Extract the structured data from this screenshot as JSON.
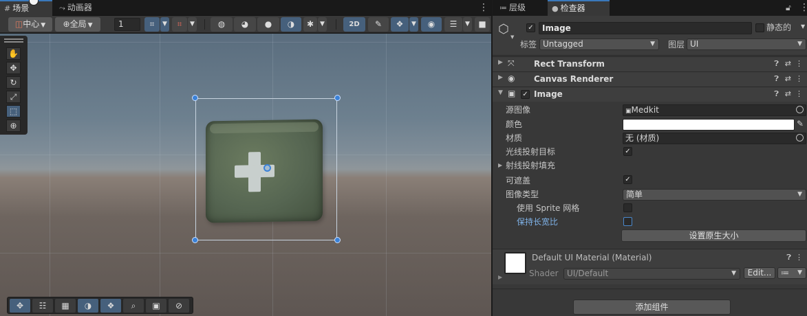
{
  "scene": {
    "tabs": [
      {
        "icon": "#",
        "label": "场景"
      },
      {
        "icon": "⤳",
        "label": "动画器"
      }
    ],
    "toolbar": {
      "pivot_label": "中心",
      "space_label": "全局",
      "grid_value": "1",
      "mode_2d": "2D"
    },
    "tools": [
      "hand-tool",
      "move-tool",
      "rotate-tool",
      "scale-tool",
      "rect-tool",
      "transform-tool"
    ]
  },
  "inspector": {
    "tabs": [
      {
        "icon": "≔",
        "label": "层级"
      },
      {
        "icon": "●",
        "label": "检查器"
      }
    ],
    "gameobject": {
      "name": "Image",
      "active": true,
      "static_label": "静态的",
      "tag_label": "标签",
      "tag_value": "Untagged",
      "layer_label": "图层",
      "layer_value": "UI"
    },
    "components": [
      {
        "title": "Rect Transform",
        "expanded": false
      },
      {
        "title": "Canvas Renderer",
        "expanded": false
      },
      {
        "title": "Image",
        "expanded": true
      }
    ],
    "image": {
      "source_label": "源图像",
      "source_value": "Medkit",
      "color_label": "颜色",
      "color_value": "#ffffff",
      "material_label": "材质",
      "material_value": "无 (材质)",
      "raycast_target_label": "光线投射目标",
      "raycast_target": true,
      "raycast_padding_label": "射线投射填充",
      "maskable_label": "可遮盖",
      "maskable": true,
      "image_type_label": "图像类型",
      "image_type_value": "简单",
      "use_sprite_mesh_label": "使用 Sprite 网格",
      "use_sprite_mesh": false,
      "preserve_aspect_label": "保持长宽比",
      "preserve_aspect": false,
      "set_native_size_label": "设置原生大小"
    },
    "material": {
      "title": "Default UI Material (Material)",
      "shader_label": "Shader",
      "shader_value": "UI/Default",
      "edit_label": "Edit..."
    },
    "add_component_label": "添加组件"
  },
  "colors": {
    "accent": "#3a79bb",
    "handle": "#3b82d8",
    "panel": "#383838"
  }
}
